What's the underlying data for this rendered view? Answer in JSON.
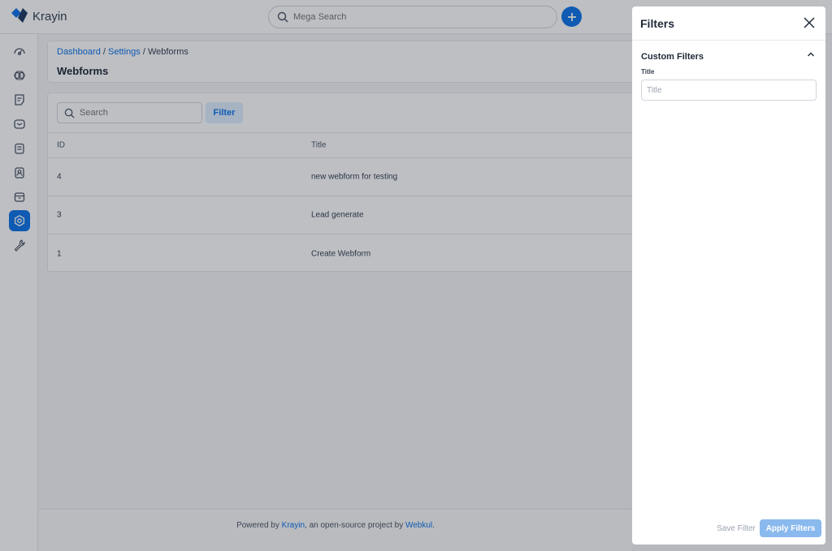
{
  "app": {
    "name": "Krayin"
  },
  "header": {
    "search_placeholder": "Mega Search"
  },
  "sidebar": {
    "items": [
      {
        "icon": "dashboard-icon"
      },
      {
        "icon": "leads-icon"
      },
      {
        "icon": "quotes-icon"
      },
      {
        "icon": "mail-icon"
      },
      {
        "icon": "activities-icon"
      },
      {
        "icon": "contacts-icon"
      },
      {
        "icon": "products-icon"
      },
      {
        "icon": "settings-icon",
        "active": true
      },
      {
        "icon": "configuration-icon"
      }
    ]
  },
  "breadcrumb": {
    "items": [
      "Dashboard",
      "Settings",
      "Webforms"
    ],
    "separator": "/"
  },
  "page": {
    "title": "Webforms"
  },
  "grid": {
    "search_placeholder": "Search",
    "filter_label": "Filter",
    "columns": [
      "ID",
      "Title"
    ],
    "rows": [
      {
        "id": "4",
        "title": "new webform for testing"
      },
      {
        "id": "3",
        "title": "Lead generate"
      },
      {
        "id": "1",
        "title": "Create Webform"
      }
    ]
  },
  "footer": {
    "prefix": "Powered by ",
    "link1": "Krayin",
    "middle": ", an open-source project by ",
    "link2": "Webkul",
    "suffix": "."
  },
  "drawer": {
    "title": "Filters",
    "section_title": "Custom Filters",
    "field_label": "Title",
    "field_placeholder": "Title",
    "save_label": "Save Filter",
    "apply_label": "Apply Filters"
  },
  "colors": {
    "accent": "#0e74e8",
    "apply_button": "#8ab9ee",
    "overlay": "rgba(17,24,39,0.28)"
  }
}
